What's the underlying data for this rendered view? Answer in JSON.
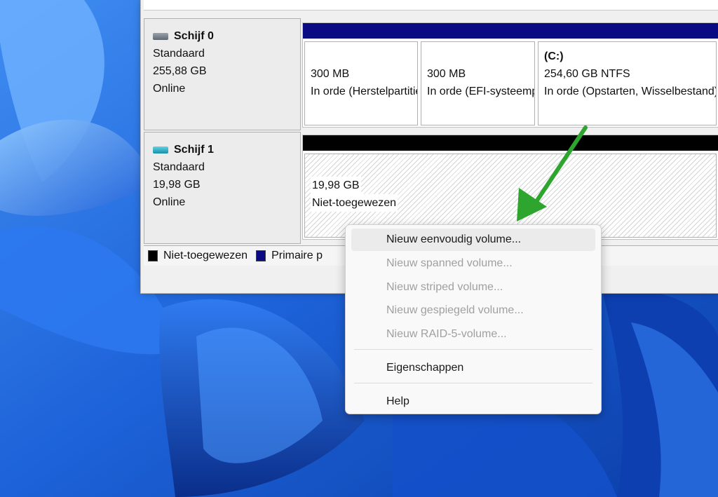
{
  "disks": [
    {
      "name": "Schijf 0",
      "type": "Standaard",
      "size": "255,88 GB",
      "status": "Online",
      "icon": "hard-disk-icon",
      "partitions": [
        {
          "title": "",
          "size": "300 MB",
          "status": "In orde (Herstelpartitie)"
        },
        {
          "title": "",
          "size": "300 MB",
          "status": "In orde (EFI-systeempartitie)"
        },
        {
          "title": "(C:)",
          "size": "254,60 GB NTFS",
          "status": "In orde (Opstarten, Wisselbestand)"
        }
      ]
    },
    {
      "name": "Schijf 1",
      "type": "Standaard",
      "size": "19,98 GB",
      "status": "Online",
      "icon": "hard-disk-icon",
      "partitions": [
        {
          "size": "19,98 GB",
          "status": "Niet-toegewezen"
        }
      ]
    }
  ],
  "legend": {
    "unallocated": "Niet-toegewezen",
    "primary": "Primaire p"
  },
  "context_menu": {
    "items": [
      {
        "label": "Nieuw eenvoudig volume...",
        "enabled": true,
        "highlighted": true
      },
      {
        "label": "Nieuw spanned volume...",
        "enabled": false
      },
      {
        "label": "Nieuw striped volume...",
        "enabled": false
      },
      {
        "label": "Nieuw gespiegeld volume...",
        "enabled": false
      },
      {
        "label": "Nieuw RAID-5-volume...",
        "enabled": false
      },
      {
        "label": "Eigenschappen",
        "enabled": true
      },
      {
        "label": "Help",
        "enabled": true
      }
    ]
  },
  "colors": {
    "primary_partition": "#0a0a82",
    "unallocated": "#000000",
    "annotation_arrow": "#2ea52e",
    "wallpaper": "#1a6fe0"
  }
}
